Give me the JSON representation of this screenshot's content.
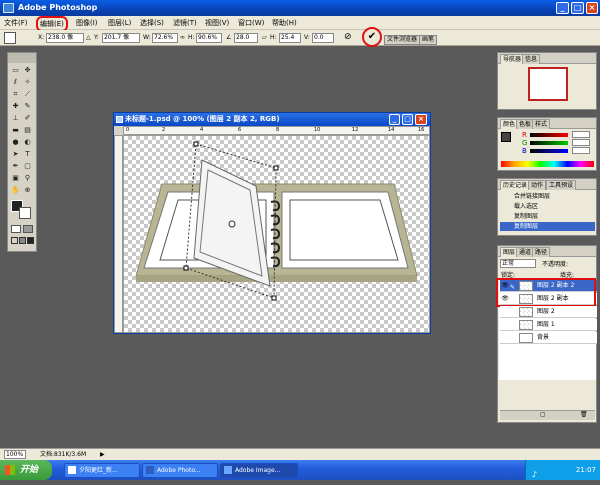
{
  "app": {
    "title": "Adobe Photoshop"
  },
  "menu": [
    "文件(F)",
    "编辑(E)",
    "图像(I)",
    "图层(L)",
    "选择(S)",
    "滤镜(T)",
    "视图(V)",
    "窗口(W)",
    "帮助(H)"
  ],
  "options": {
    "x_label": "X:",
    "x_value": "238.0 像",
    "y_label": "Y:",
    "y_value": "201.7 像",
    "w_label": "W:",
    "w_value": "72.6%",
    "h_label": "H:",
    "h_value": "90.6%",
    "angle_value": "28.0",
    "hskew_label": "H:",
    "hskew_value": "25.4",
    "vskew_label": "V:",
    "vskew_value": "0.0",
    "tab_filebrowser": "文件浏览器",
    "tab_brushes": "画笔"
  },
  "document": {
    "title": "未标题-1.psd @ 100% (图层 2 副本 2, RGB)",
    "ruler_marks": [
      "0",
      "2",
      "4",
      "6",
      "8",
      "10",
      "12",
      "14",
      "16"
    ]
  },
  "navigator": {
    "tabs": [
      "导航器",
      "信息"
    ]
  },
  "color": {
    "tabs": [
      "颜色",
      "色板",
      "样式"
    ],
    "labels": [
      "R",
      "G",
      "B"
    ]
  },
  "history": {
    "tabs": [
      "历史记录",
      "动作",
      "工具预设"
    ],
    "items": [
      "合并链接图层",
      "载入选区",
      "复制图层",
      "复制图层"
    ]
  },
  "layers": {
    "tabs": [
      "图层",
      "通道",
      "路径"
    ],
    "blend_mode": "正常",
    "opacity_label": "不透明度:",
    "lock_label": "锁定:",
    "fill_label": "填充:",
    "items": [
      "图层 2 副本 2",
      "图层 2 副本",
      "图层 2",
      "图层 1",
      "背景"
    ]
  },
  "status": {
    "zoom": "100%",
    "doc_size": "文档:831K/3.6M"
  },
  "taskbar": {
    "start": "开始",
    "buttons": [
      "夕阳更红_新...",
      "Adobe Photo...",
      "Adobe Image..."
    ],
    "time": "21:07"
  },
  "colors": {
    "accent": "#0a47c4",
    "highlight": "#e01010",
    "selection": "#3a66c8"
  }
}
